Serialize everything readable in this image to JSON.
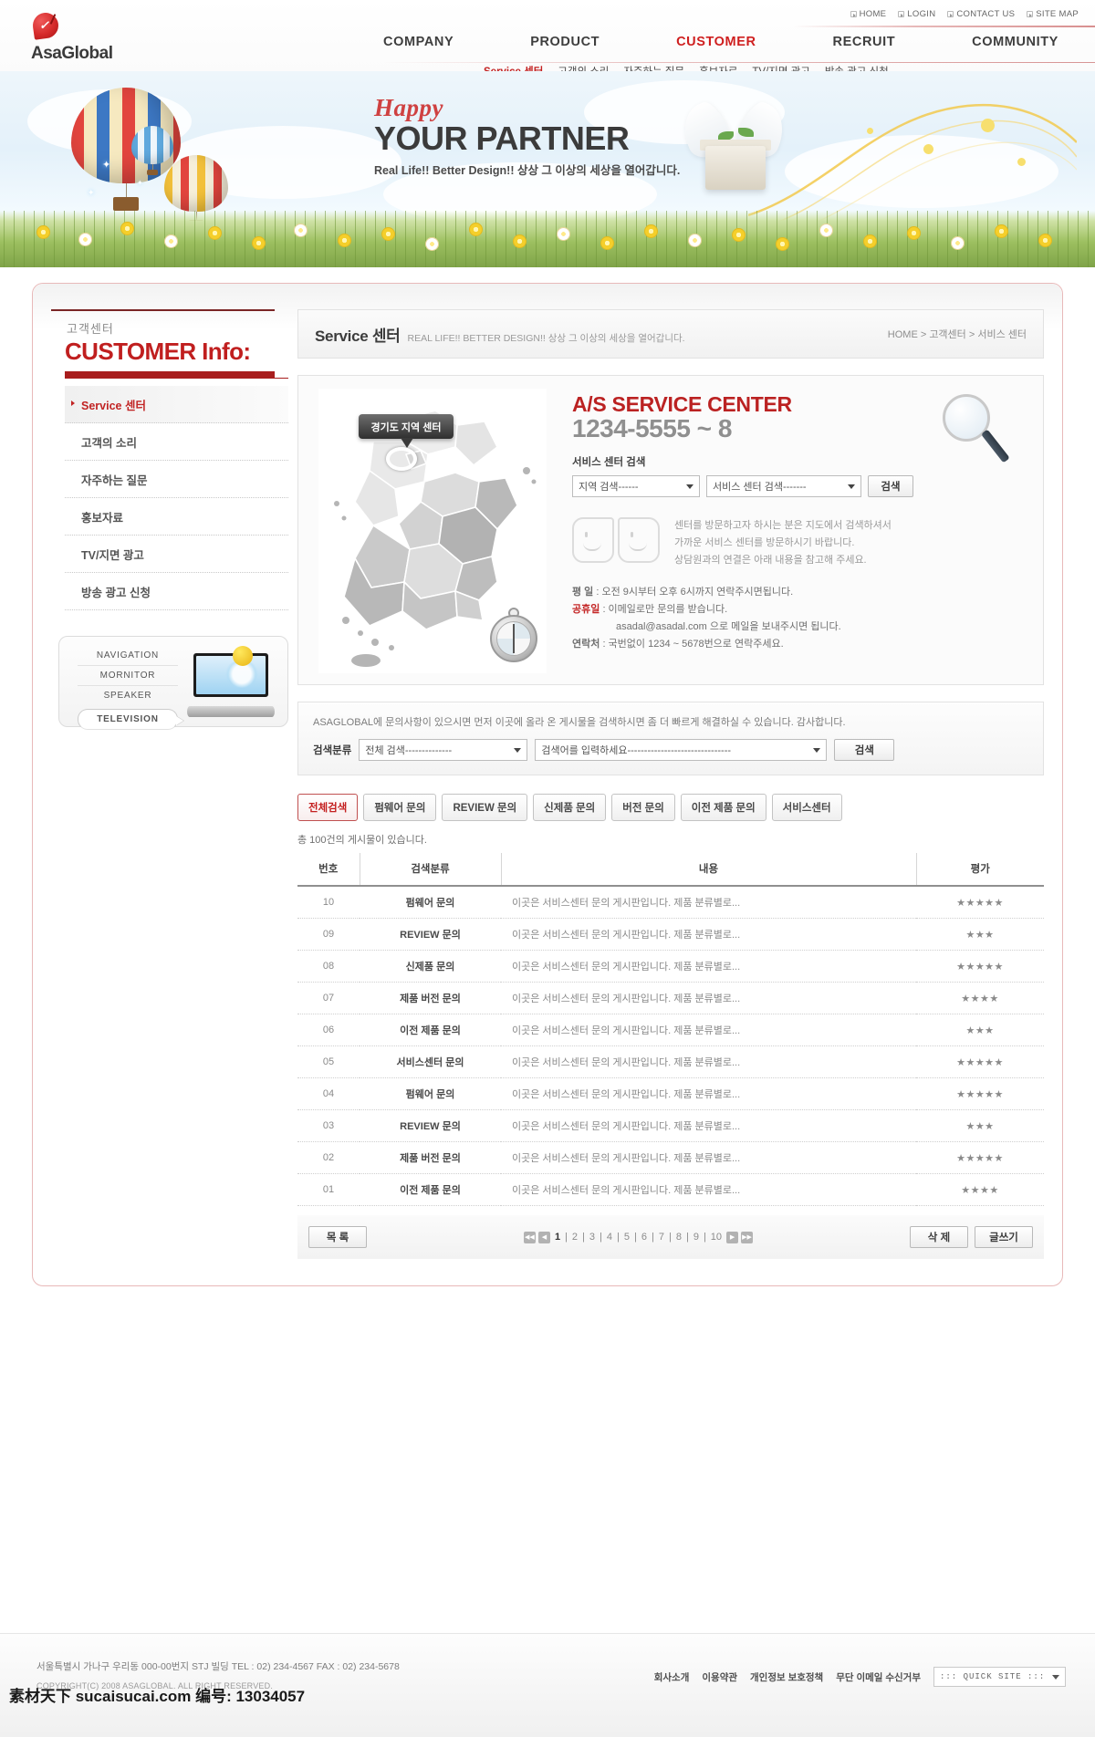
{
  "brand": {
    "name": "AsaGlobal"
  },
  "utility": [
    {
      "label": "HOME"
    },
    {
      "label": "LOGIN"
    },
    {
      "label": "CONTACT US"
    },
    {
      "label": "SITE MAP"
    }
  ],
  "mainnav": [
    {
      "label": "COMPANY",
      "active": false
    },
    {
      "label": "PRODUCT",
      "active": false
    },
    {
      "label": "CUSTOMER",
      "active": true
    },
    {
      "label": "RECRUIT",
      "active": false
    },
    {
      "label": "COMMUNITY",
      "active": false
    }
  ],
  "subnav": [
    {
      "label": "Service 센터",
      "active": true
    },
    {
      "label": "고객의 소리",
      "active": false
    },
    {
      "label": "자주하는 질문",
      "active": false
    },
    {
      "label": "홍보자료",
      "active": false
    },
    {
      "label": "TV/지면 광고",
      "active": false
    },
    {
      "label": "방송 광고 신청",
      "active": false
    }
  ],
  "banner": {
    "happy": "Happy",
    "headline": "YOUR PARTNER",
    "subline": "Real Life!! Better Design!! 상상 그 이상의 세상을 열어갑니다."
  },
  "sidebar": {
    "ko_label": "고객센터",
    "title": "CUSTOMER Info:",
    "items": [
      {
        "label": "Service 센터",
        "active": true
      },
      {
        "label": "고객의 소리",
        "active": false
      },
      {
        "label": "자주하는 질문",
        "active": false
      },
      {
        "label": "홍보자료",
        "active": false
      },
      {
        "label": "TV/지면 광고",
        "active": false
      },
      {
        "label": "방송 광고 신청",
        "active": false
      }
    ],
    "promo": {
      "items": [
        "NAVIGATION",
        "MORNITOR",
        "SPEAKER"
      ],
      "highlight": "TELEVISION"
    }
  },
  "page": {
    "title": "Service 센터",
    "tagline": "REAL LIFE!! BETTER DESIGN!! 상상 그 이상의 세상을 열어갑니다.",
    "breadcrumb": "HOME > 고객센터 > 서비스 센터"
  },
  "as_center": {
    "map_tooltip": "경기도 지역 센터",
    "heading": "A/S SERVICE CENTER",
    "phone": "1234-5555 ~ 8",
    "search_label": "서비스 센터 검색",
    "region_select": "지역 검색------",
    "center_select": "서비스 센터 검색-------",
    "search_button": "검색",
    "note_line1": "센터를 방문하고자 하시는 분은 지도에서 검색하셔서",
    "note_line2": "가까운 서비스 센터를 방문하시기 바랍니다.",
    "note_line3": "상담원과의 연결은 아래 내용을 참고해 주세요.",
    "hours_weekday_label": "평   일",
    "hours_weekday_value": ": 오전 9시부터 오후 6시까지 연락주시면됩니다.",
    "hours_holiday_label": "공휴일",
    "hours_holiday_value": ": 이메일로만 문의를 받습니다.",
    "hours_email": "asadal@asadal.com 으로 메일을 보내주시면 됩니다.",
    "hours_contact_label": "연락처",
    "hours_contact_value": ": 국번없이 1234 ~ 5678번으로 연락주세요."
  },
  "board_search": {
    "note": "ASAGLOBAL에 문의사항이 있으시면 먼저 이곳에 올라 온 게시물을 검색하시면 좀 더 빠르게 해결하실 수 있습니다. 감사합니다.",
    "label": "검색분류",
    "category_select": "전체 검색--------------",
    "keyword_select": "검색어를 입력하세요-------------------------------",
    "button": "검색"
  },
  "tabs": [
    {
      "label": "전체검색",
      "active": true
    },
    {
      "label": "펌웨어 문의",
      "active": false
    },
    {
      "label": "REVIEW 문의",
      "active": false
    },
    {
      "label": "신제품 문의",
      "active": false
    },
    {
      "label": "버전 문의",
      "active": false
    },
    {
      "label": "이전 제품 문의",
      "active": false
    },
    {
      "label": "서비스센터",
      "active": false
    }
  ],
  "board": {
    "count_text": "총 100건의 게시물이 있습니다.",
    "headers": [
      "번호",
      "검색분류",
      "내용",
      "평가"
    ],
    "rows": [
      {
        "no": "10",
        "cat": "펌웨어 문의",
        "body": "이곳은 서비스센터 문의 게시판입니다. 제품 분류별로...",
        "stars": "★★★★★"
      },
      {
        "no": "09",
        "cat": "REVIEW 문의",
        "body": "이곳은 서비스센터 문의 게시판입니다. 제품 분류별로...",
        "stars": "★★★"
      },
      {
        "no": "08",
        "cat": "신제품 문의",
        "body": "이곳은 서비스센터 문의 게시판입니다. 제품 분류별로...",
        "stars": "★★★★★"
      },
      {
        "no": "07",
        "cat": "제품 버전 문의",
        "body": "이곳은 서비스센터 문의 게시판입니다. 제품 분류별로...",
        "stars": "★★★★"
      },
      {
        "no": "06",
        "cat": "이전 제품 문의",
        "body": "이곳은 서비스센터 문의 게시판입니다. 제품 분류별로...",
        "stars": "★★★"
      },
      {
        "no": "05",
        "cat": "서비스센터 문의",
        "body": "이곳은 서비스센터 문의 게시판입니다. 제품 분류별로...",
        "stars": "★★★★★"
      },
      {
        "no": "04",
        "cat": "펌웨어 문의",
        "body": "이곳은 서비스센터 문의 게시판입니다. 제품 분류별로...",
        "stars": "★★★★★"
      },
      {
        "no": "03",
        "cat": "REVIEW 문의",
        "body": "이곳은 서비스센터 문의 게시판입니다. 제품 분류별로...",
        "stars": "★★★"
      },
      {
        "no": "02",
        "cat": "제품 버전 문의",
        "body": "이곳은 서비스센터 문의 게시판입니다. 제품 분류별로...",
        "stars": "★★★★★"
      },
      {
        "no": "01",
        "cat": "이전 제품 문의",
        "body": "이곳은 서비스센터 문의 게시판입니다. 제품 분류별로...",
        "stars": "★★★★"
      }
    ]
  },
  "pager": {
    "list_button": "목 록",
    "pages": [
      "1",
      "2",
      "3",
      "4",
      "5",
      "6",
      "7",
      "8",
      "9",
      "10"
    ],
    "current": "1",
    "delete_button": "삭 제",
    "write_button": "글쓰기"
  },
  "footer": {
    "address": "서울특별시 가나구 우리동 000-00번지 STJ 빌딩  TEL : 02) 234-4567  FAX : 02) 234-5678",
    "copyright": "COPYRIGHT(C) 2008 ASAGLOBAL. ALL RIGHT RESERVED.",
    "links": [
      "회사소개",
      "이용약관",
      "개인정보 보호정책",
      "무단 이메일 수신거부"
    ],
    "quick_site": "::: QUICK SITE :::",
    "watermark": "素材天下 sucaisucai.com  编号: 13034057"
  },
  "colors": {
    "accent": "#c42020",
    "dark_red": "#a81d1d",
    "muted": "#8a8a8a"
  }
}
